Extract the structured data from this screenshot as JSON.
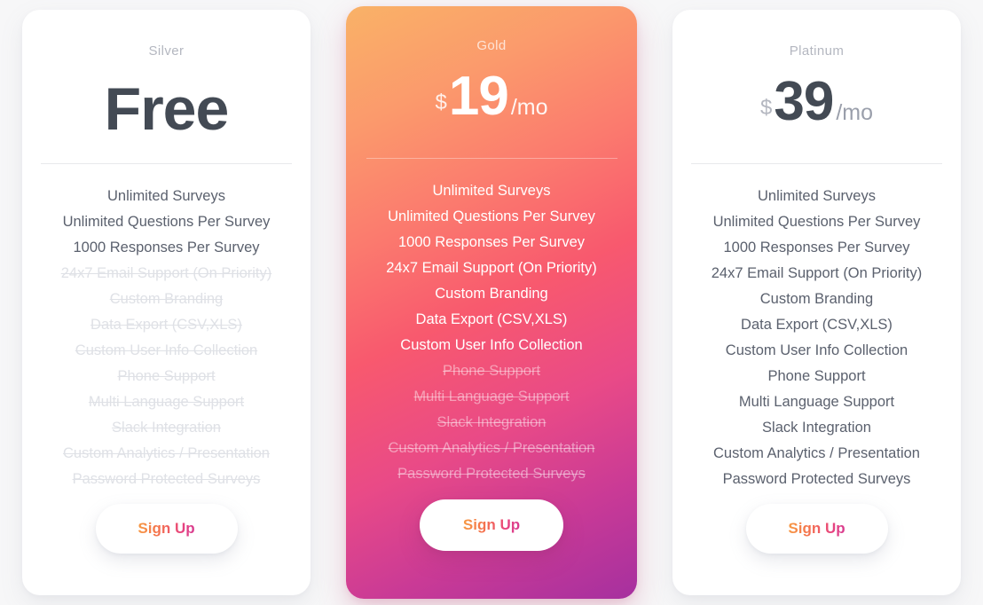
{
  "features_order": [
    "Unlimited Surveys",
    "Unlimited Questions Per Survey",
    "1000 Responses Per Survey",
    "24x7 Email Support (On Priority)",
    "Custom Branding",
    "Data Export (CSV,XLS)",
    "Custom User Info Collection",
    "Phone Support",
    "Multi Language Support",
    "Slack Integration",
    "Custom Analytics / Presentation",
    "Password Protected Surveys"
  ],
  "signup_label": "Sign Up",
  "colors": {
    "page_background": "#f7f7f8",
    "card_background": "#ffffff",
    "price_dark": "#434a54",
    "plan_name_gray": "#b4b7c0",
    "feature_active": "#5b616e",
    "feature_disabled": "#dfe1e6",
    "gradient_start": "#f9b267",
    "gradient_mid": "#f8596e",
    "gradient_end": "#a6309f",
    "signup_gradient_start": "#f79c42",
    "signup_gradient_end": "#d63b93"
  },
  "plans": [
    {
      "name": "Silver",
      "price_display": "Free",
      "currency": "",
      "amount": "",
      "period": "",
      "featured": false,
      "features": [
        {
          "label": "Unlimited Surveys",
          "included": true
        },
        {
          "label": "Unlimited Questions Per Survey",
          "included": true
        },
        {
          "label": "1000 Responses Per Survey",
          "included": true
        },
        {
          "label": "24x7 Email Support (On Priority)",
          "included": false
        },
        {
          "label": "Custom Branding",
          "included": false
        },
        {
          "label": "Data Export (CSV,XLS)",
          "included": false
        },
        {
          "label": "Custom User Info Collection",
          "included": false
        },
        {
          "label": "Phone Support",
          "included": false
        },
        {
          "label": "Multi Language Support",
          "included": false
        },
        {
          "label": "Slack Integration",
          "included": false
        },
        {
          "label": "Custom Analytics / Presentation",
          "included": false
        },
        {
          "label": "Password Protected Surveys",
          "included": false
        }
      ]
    },
    {
      "name": "Gold",
      "price_display": "$19/mo",
      "currency": "$",
      "amount": "19",
      "period": "/mo",
      "featured": true,
      "features": [
        {
          "label": "Unlimited Surveys",
          "included": true
        },
        {
          "label": "Unlimited Questions Per Survey",
          "included": true
        },
        {
          "label": "1000 Responses Per Survey",
          "included": true
        },
        {
          "label": "24x7 Email Support (On Priority)",
          "included": true
        },
        {
          "label": "Custom Branding",
          "included": true
        },
        {
          "label": "Data Export (CSV,XLS)",
          "included": true
        },
        {
          "label": "Custom User Info Collection",
          "included": true
        },
        {
          "label": "Phone Support",
          "included": false
        },
        {
          "label": "Multi Language Support",
          "included": false
        },
        {
          "label": "Slack Integration",
          "included": false
        },
        {
          "label": "Custom Analytics / Presentation",
          "included": false
        },
        {
          "label": "Password Protected Surveys",
          "included": false
        }
      ]
    },
    {
      "name": "Platinum",
      "price_display": "$39/mo",
      "currency": "$",
      "amount": "39",
      "period": "/mo",
      "featured": false,
      "features": [
        {
          "label": "Unlimited Surveys",
          "included": true
        },
        {
          "label": "Unlimited Questions Per Survey",
          "included": true
        },
        {
          "label": "1000 Responses Per Survey",
          "included": true
        },
        {
          "label": "24x7 Email Support (On Priority)",
          "included": true
        },
        {
          "label": "Custom Branding",
          "included": true
        },
        {
          "label": "Data Export (CSV,XLS)",
          "included": true
        },
        {
          "label": "Custom User Info Collection",
          "included": true
        },
        {
          "label": "Phone Support",
          "included": true
        },
        {
          "label": "Multi Language Support",
          "included": true
        },
        {
          "label": "Slack Integration",
          "included": true
        },
        {
          "label": "Custom Analytics / Presentation",
          "included": true
        },
        {
          "label": "Password Protected Surveys",
          "included": true
        }
      ]
    }
  ]
}
